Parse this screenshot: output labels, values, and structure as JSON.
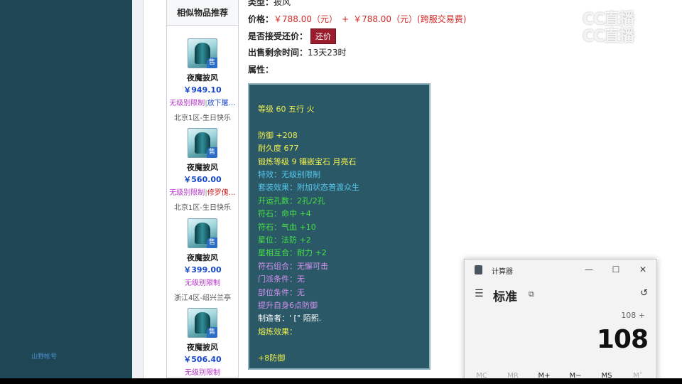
{
  "left_panel": {
    "link_text": "山野帐号"
  },
  "similar": {
    "title": "相似物品推荐",
    "items": [
      {
        "name": "夜魔披风",
        "price": "￥949.10",
        "tag_a": "无级别限制",
        "tag_sep": "|",
        "tag_b": "放下屠…",
        "server": "北京1区-生日快乐"
      },
      {
        "name": "夜魔披风",
        "price": "￥560.00",
        "tag_a": "无级别限制",
        "tag_sep": "|",
        "tag_b": "修罗傀…",
        "server": "北京1区-生日快乐"
      },
      {
        "name": "夜魔披风",
        "price": "￥399.00",
        "tag_a": "无级别限制",
        "tag_sep": "",
        "tag_b": "",
        "server": "浙江4区-绍兴兰亭"
      },
      {
        "name": "夜魔披风",
        "price": "￥506.40",
        "tag_a": "无级别限制",
        "tag_sep": "",
        "tag_b": "",
        "server": ""
      }
    ],
    "sell_badge": "售"
  },
  "detail": {
    "type_label": "类型：",
    "type_value": "披风",
    "price_label": "价格：",
    "price_value": "￥788.00（元）",
    "price_plus": "+",
    "price_cross": "￥788.00（元）(跨服交易费)",
    "bargain_label": "是否接受还价：",
    "bargain_button": "还价",
    "time_label": "出售剩余时间：",
    "time_value": "13天23时",
    "attr_label": "属性："
  },
  "attributes": [
    {
      "text": "等级 60 五行 火",
      "color": "y"
    },
    {
      "text": "",
      "color": "gap"
    },
    {
      "text": "防御 +208",
      "color": "y"
    },
    {
      "text": "耐久度 677",
      "color": "y"
    },
    {
      "text": "锻炼等级 9 镶嵌宝石 月亮石",
      "color": "y"
    },
    {
      "text": "特效：无级别限制",
      "color": "c"
    },
    {
      "text": "套装效果：附加状态普渡众生",
      "color": "c"
    },
    {
      "text": "开运孔数：2孔/2孔",
      "color": "g"
    },
    {
      "text": "符石：命中 +4",
      "color": "g"
    },
    {
      "text": "符石：气血 +10",
      "color": "g"
    },
    {
      "text": "星位：法防 +2",
      "color": "g"
    },
    {
      "text": "星相互合：耐力 +2",
      "color": "g"
    },
    {
      "text": "符石组合：无懈可击",
      "color": "p"
    },
    {
      "text": "门派条件：无",
      "color": "p"
    },
    {
      "text": "部位条件：无",
      "color": "p"
    },
    {
      "text": "提升自身6点防御",
      "color": "p"
    },
    {
      "text": "制造者：' [° 陌熙.",
      "color": "w"
    },
    {
      "text": "熔炼效果：",
      "color": "y"
    },
    {
      "text": "",
      "color": "gap"
    },
    {
      "text": "+8防御",
      "color": "y"
    }
  ],
  "watermark": {
    "line1": "CC直播",
    "line2": "CC直播"
  },
  "calculator": {
    "title": "计算器",
    "mode": "标准",
    "expression": "108 +",
    "display": "108",
    "minimize": "—",
    "maximize": "☐",
    "close": "✕",
    "menu_glyph": "☰",
    "keep_glyph": "⧉",
    "history_glyph": "↺",
    "memory": [
      "MC",
      "MR",
      "M+",
      "M−",
      "MS",
      "M˅"
    ]
  }
}
